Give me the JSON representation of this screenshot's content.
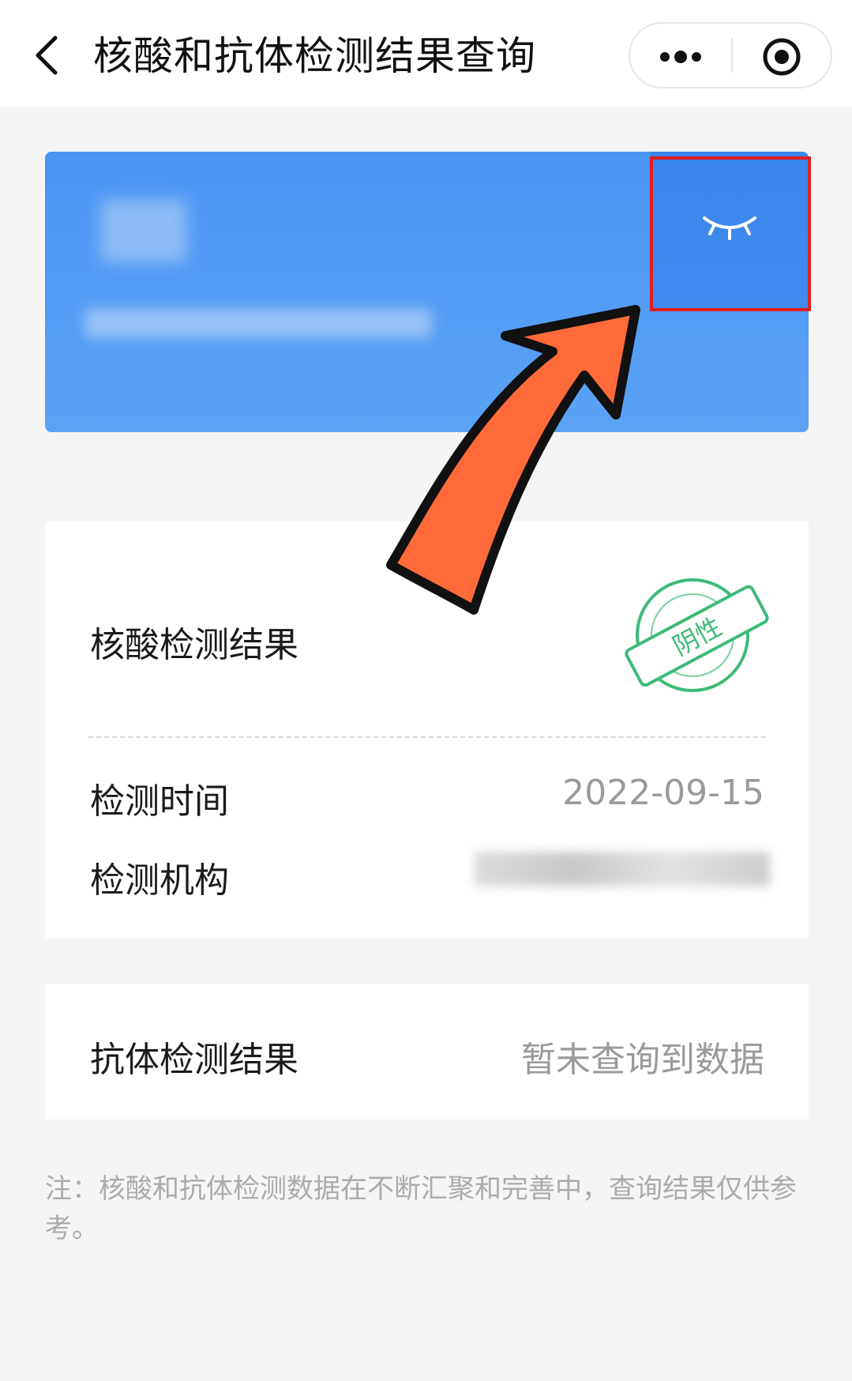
{
  "header": {
    "title": "核酸和抗体检测结果查询"
  },
  "nucleic_card": {
    "title": "核酸检测结果",
    "stamp_text": "阴性",
    "rows": [
      {
        "label": "检测时间",
        "value": "2022-09-15"
      },
      {
        "label": "检测机构",
        "value": ""
      }
    ]
  },
  "antibody_card": {
    "title": "抗体检测结果",
    "value": "暂未查询到数据"
  },
  "note": "注：核酸和抗体检测数据在不断汇聚和完善中，查询结果仅供参考。",
  "colors": {
    "card_blue": "#4a95f3",
    "highlight_red": "#e02020",
    "arrow_orange": "#ff6a3a",
    "stamp_green": "#3dbb78"
  },
  "icons": [
    "back-icon",
    "more-dots-icon",
    "record-target-icon",
    "eye-closed-icon"
  ]
}
